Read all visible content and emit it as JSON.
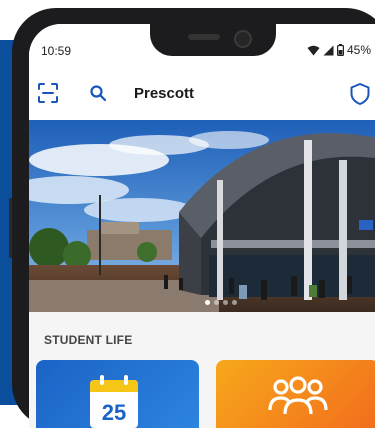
{
  "status_bar": {
    "time": "10:59",
    "battery": "45%"
  },
  "app_bar": {
    "title": "Prescott"
  },
  "hero": {
    "carousel_pages": 4,
    "active_page": 1
  },
  "student_life": {
    "title": "STUDENT LIFE",
    "cards": [
      {
        "icon": "calendar-icon",
        "calendar_day": "25",
        "color": "#1b63c6"
      },
      {
        "icon": "people-group-icon",
        "color": "#f7931e"
      }
    ]
  },
  "colors": {
    "brand_blue": "#0b4f9c",
    "icon_blue": "#1a56b8"
  }
}
